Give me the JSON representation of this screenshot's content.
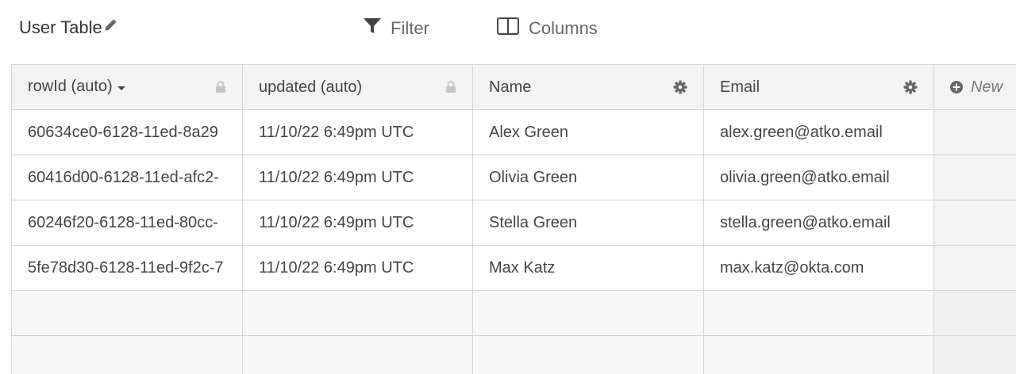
{
  "toolbar": {
    "title": "User Table",
    "filter_label": "Filter",
    "columns_label": "Columns"
  },
  "table": {
    "columns": [
      {
        "label": "rowId (auto)",
        "icon": "lock-icon"
      },
      {
        "label": "updated (auto)",
        "icon": "lock-icon"
      },
      {
        "label": "Name",
        "icon": "gear-icon"
      },
      {
        "label": "Email",
        "icon": "gear-icon"
      }
    ],
    "new_column_label": "New",
    "rows": [
      [
        "60634ce0-6128-11ed-8a29",
        "11/10/22 6:49pm UTC",
        "Alex Green",
        "alex.green@atko.email"
      ],
      [
        "60416d00-6128-11ed-afc2-",
        "11/10/22 6:49pm UTC",
        "Olivia Green",
        "olivia.green@atko.email"
      ],
      [
        "60246f20-6128-11ed-80cc-",
        "11/10/22 6:49pm UTC",
        "Stella Green",
        "stella.green@atko.email"
      ],
      [
        "5fe78d30-6128-11ed-9f2c-7",
        "11/10/22 6:49pm UTC",
        "Max Katz",
        "max.katz@okta.com"
      ]
    ]
  },
  "colors": {
    "header_bg": "#f3f3f3",
    "border": "#d3d3d3",
    "text": "#444444",
    "icon": "#666666"
  }
}
